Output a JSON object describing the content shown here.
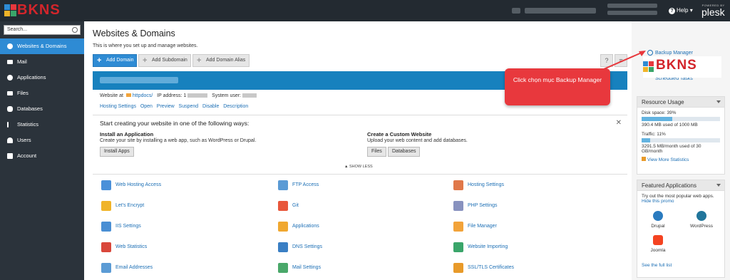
{
  "brand": {
    "logo_text": "BKNS"
  },
  "topbar": {
    "help_label": "Help",
    "help_caret": "▾",
    "powered_by": "POWERED BY",
    "plesk": "plesk"
  },
  "sidebar": {
    "search_placeholder": "Search...",
    "items": [
      {
        "label": "Websites & Domains"
      },
      {
        "label": "Mail"
      },
      {
        "label": "Applications"
      },
      {
        "label": "Files"
      },
      {
        "label": "Databases"
      },
      {
        "label": "Statistics"
      },
      {
        "label": "Users"
      },
      {
        "label": "Account"
      }
    ]
  },
  "main": {
    "title": "Websites & Domains",
    "subtitle": "This is where you set up and manage websites.",
    "toolbar": {
      "add_domain": "Add Domain",
      "add_subdomain": "Add Subdomain",
      "add_alias": "Add Domain Alias"
    },
    "meta": {
      "website_at": "Website at",
      "docroot": "httpdocs/",
      "ip_label": "IP address:",
      "ip_value": "1",
      "system_user": "System user:"
    },
    "links": [
      "Hosting Settings",
      "Open",
      "Preview",
      "Suspend",
      "Disable",
      "Description"
    ],
    "create": {
      "title": "Start creating your website in one of the following ways:",
      "install_heading": "Install an Application",
      "install_text": "Create your site by installing a web app, such as WordPress or Drupal.",
      "install_button": "Install Apps",
      "custom_heading": "Create a Custom Website",
      "custom_text": "Upload your web content and add databases.",
      "files_button": "Files",
      "databases_button": "Databases"
    },
    "show_less": "SHOW LESS",
    "tools": [
      {
        "label": "Web Hosting Access",
        "color": "#4a90d9"
      },
      {
        "label": "FTP Access",
        "color": "#5b9bd5"
      },
      {
        "label": "Hosting Settings",
        "color": "#e0784a"
      },
      {
        "label": "Let's Encrypt",
        "color": "#f0b429"
      },
      {
        "label": "Git",
        "color": "#e8573b"
      },
      {
        "label": "PHP Settings",
        "color": "#8892bf"
      },
      {
        "label": "IIS Settings",
        "color": "#4a8fd4"
      },
      {
        "label": "Applications",
        "color": "#f0a830"
      },
      {
        "label": "File Manager",
        "color": "#f2a33a"
      },
      {
        "label": "Web Statistics",
        "color": "#d9473b"
      },
      {
        "label": "DNS Settings",
        "color": "#3a7fc4"
      },
      {
        "label": "Website Importing",
        "color": "#3aa56a"
      },
      {
        "label": "Email Addresses",
        "color": "#5b9bd5"
      },
      {
        "label": "Mail Settings",
        "color": "#4aa86a"
      },
      {
        "label": "SSL/TLS Certificates",
        "color": "#e89a2a"
      }
    ]
  },
  "right": {
    "backup_manager": "Backup Manager",
    "scheduled_tasks": "Scheduled Tasks",
    "resource": {
      "title": "Resource Usage",
      "disk_label": "Disk space: 39%",
      "disk_percent": 39,
      "disk_text": "390.4 MB used of 1000 MB",
      "traffic_label": "Traffic: 11%",
      "traffic_percent": 11,
      "traffic_text": "3291.5 MB/month used of 30 GB/month",
      "more_stats": "View More Statistics"
    },
    "featured": {
      "title": "Featured Applications",
      "intro": "Try out the most popular web apps.",
      "hide_promo": "Hide this promo",
      "apps": [
        "Drupal",
        "WordPress",
        "Joomla"
      ],
      "full_list": "See the full list"
    }
  },
  "callout": {
    "text": "Click chọn mục Backup Manager",
    "overlay_logo": "BKNS"
  },
  "colors": {
    "accent": "#2e8bd4",
    "topbar": "#232a31",
    "sidebar": "#2b333b",
    "callout": "#e8383d",
    "brand_red": "#d3252b"
  }
}
